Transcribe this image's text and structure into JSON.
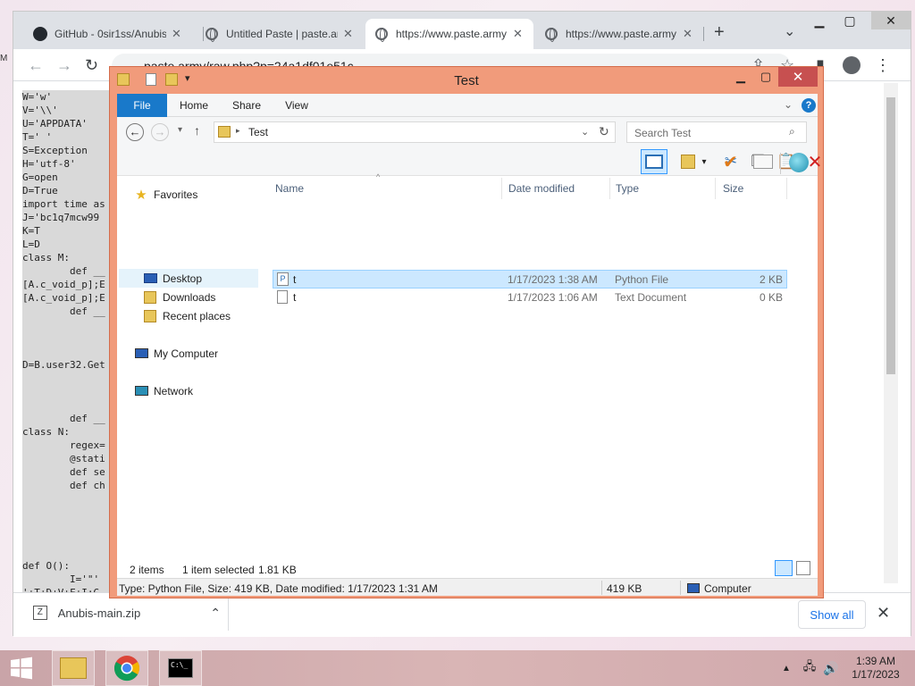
{
  "browser": {
    "tabs": [
      {
        "title": "GitHub - 0sir1ss/Anubis",
        "icon": "github-icon"
      },
      {
        "title": "Untitled Paste | paste.ar",
        "icon": "globe-icon"
      },
      {
        "title": "https://www.paste.army",
        "icon": "globe-icon",
        "active": true
      },
      {
        "title": "https://www.paste.army",
        "icon": "globe-icon"
      }
    ],
    "new_tab": "+",
    "tab_search": "⌄",
    "url": "paste.army/raw.php?p=24a1df01e51c",
    "page_lines": [
      "W='w'",
      "V='\\\\'",
      "U='APPDATA'",
      "T=' '",
      "S=Exception",
      "H='utf-8'",
      "G=open",
      "D=True",
      "import time as",
      "J='bc1q7mcw99",
      "K=T",
      "L=D",
      "class M:",
      "        def __",
      "[A.c_void_p];E",
      "[A.c_void_p];E",
      "        def __",
      "",
      "",
      "",
      "D=B.user32.Get",
      "",
      "",
      "",
      "        def __",
      "class N:",
      "        regex=",
      "        @stati",
      "        def se",
      "        def ch",
      "",
      "",
      "",
      "",
      "",
      "def O():",
      "        I='\"'",
      "'+T+D+V+F+I:G"
    ],
    "download": {
      "filename": "Anubis-main.zip",
      "show_all": "Show all"
    }
  },
  "explorer": {
    "title": "Test",
    "ribbon_tabs": [
      "File",
      "Home",
      "Share",
      "View"
    ],
    "address_path": "Test",
    "search_placeholder": "Search Test",
    "nav": {
      "favorites": "Favorites",
      "items": [
        "Desktop",
        "Downloads",
        "Recent places"
      ],
      "computer": "My Computer",
      "network": "Network"
    },
    "columns": [
      "Name",
      "Date modified",
      "Type",
      "Size"
    ],
    "files": [
      {
        "name": "t",
        "date": "1/17/2023 1:38 AM",
        "type": "Python File",
        "size": "2 KB",
        "selected": true
      },
      {
        "name": "t",
        "date": "1/17/2023 1:06 AM",
        "type": "Text Document",
        "size": "0 KB",
        "selected": false
      }
    ],
    "status": {
      "items": "2 items",
      "selected": "1 item selected",
      "sel_size": "1.81 KB"
    },
    "detail": {
      "info": "Type: Python File, Size: 419 KB, Date modified: 1/17/2023 1:31 AM",
      "size": "419 KB",
      "location": "Computer"
    }
  },
  "taskbar": {
    "time": "1:39 AM",
    "date": "1/17/2023",
    "console_text": "C:\\_"
  }
}
